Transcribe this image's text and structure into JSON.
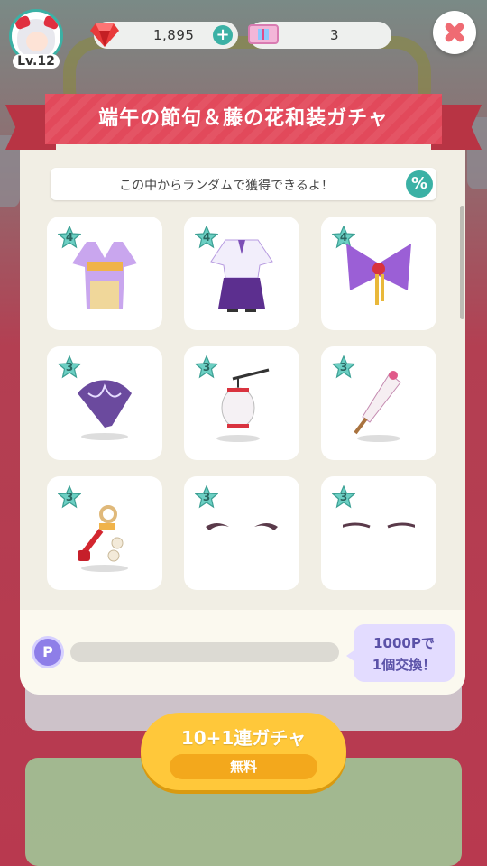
{
  "player": {
    "level": "Lv.12"
  },
  "currency": {
    "gems": "1,895",
    "tickets": "3"
  },
  "dialog": {
    "title": "端午の節句＆藤の花和装ガチャ",
    "notice": "この中からランダムで獲得できるよ！",
    "rate_icon": "%",
    "items": [
      {
        "rarity": "4",
        "icon": "kimono-icon"
      },
      {
        "rarity": "4",
        "icon": "hakama-icon"
      },
      {
        "rarity": "4",
        "icon": "ribbon-bow-icon"
      },
      {
        "rarity": "3",
        "icon": "folding-fan-icon"
      },
      {
        "rarity": "3",
        "icon": "lantern-icon"
      },
      {
        "rarity": "3",
        "icon": "parasol-stick-icon"
      },
      {
        "rarity": "3",
        "icon": "tassel-ornament-icon"
      },
      {
        "rarity": "3",
        "icon": "eyebrows-icon"
      },
      {
        "rarity": "3",
        "icon": "thin-eyebrows-icon"
      }
    ],
    "points": {
      "icon_label": "P",
      "progress": 0,
      "exchange_line1": "1000Pで",
      "exchange_line2": "1個交換！"
    }
  },
  "gacha_button": {
    "label": "10+1連ガチャ",
    "price": "無料"
  },
  "colors": {
    "accent": "#3bb1a5",
    "banner": "#e2495b",
    "button": "#ffc83a",
    "points": "#8e7ee8"
  }
}
